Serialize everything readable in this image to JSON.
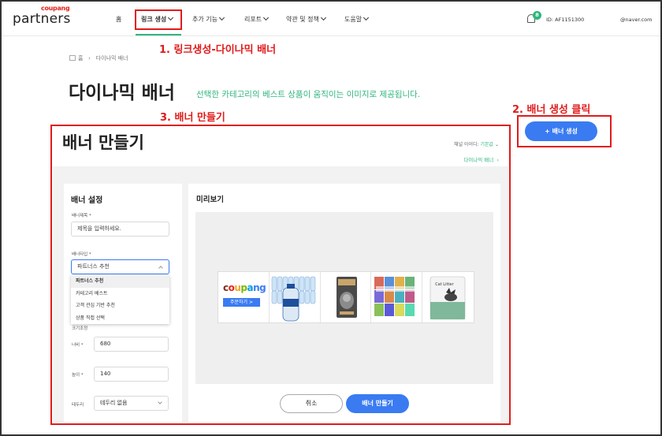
{
  "header": {
    "logo_small": "coupang",
    "logo_main": "partners",
    "nav": [
      "홈",
      "링크 생성",
      "추가 기능",
      "리포트",
      "약관 및 정책",
      "도움말"
    ],
    "notification_count": "8",
    "user_id": "ID: AF1151300",
    "email": "@naver.com"
  },
  "annotations": {
    "step1": "1. 링크생성-다이나믹 배너",
    "step2": "2. 배너 생성 클릭",
    "step3": "3. 배너 만들기",
    "color": "#e01b1b"
  },
  "breadcrumb": {
    "home": "홈",
    "current": "다이나믹 배너"
  },
  "page": {
    "title": "다이나믹 배너",
    "description": "선택한 카테고리의 베스트 상품이 움직이는 이미지로 제공됩니다.",
    "create_button": "+  배너 생성"
  },
  "panel": {
    "title": "배너 만들기",
    "channel_label": "채널 아이디:",
    "channel_value": "기본값",
    "link": "다이나믹 배너"
  },
  "settings": {
    "title": "배너 설정",
    "name_label": "배너제목 *",
    "name_placeholder": "제목을 입력하세요.",
    "type_label": "배너타입 *",
    "type_value": "파트너스 추천",
    "type_options": [
      "파트너스 추천",
      "카테고리 베스트",
      "고객 관심 기반 추천",
      "상품 직접 선택"
    ],
    "size_label": "크기조정",
    "width_label": "너비 *",
    "width_value": "680",
    "height_label": "높이 *",
    "height_value": "140",
    "border_label": "테두리",
    "border_value": "테두리 없음"
  },
  "preview": {
    "title": "미리보기",
    "logo_text": "coupang",
    "order_button": "주문하기 >",
    "products": [
      "water-bottles-pack",
      "dog-food-bag",
      "book-covers",
      "cat-litter-bag"
    ],
    "cat_litter_text": "Cat Litter"
  },
  "actions": {
    "cancel": "취소",
    "make": "배너 만들기"
  },
  "colors": {
    "accent_green": "#2eb67d",
    "button_blue": "#3a7bf2",
    "coupang_red": "#e1251b"
  }
}
